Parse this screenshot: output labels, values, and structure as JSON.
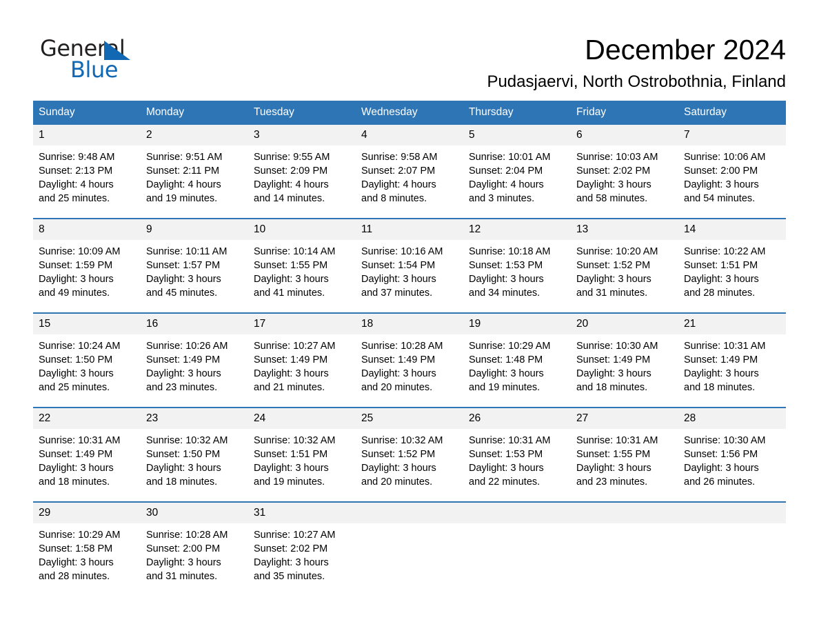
{
  "logo": {
    "word_one": "General",
    "word_two": "Blue",
    "triangle_icon": "triangle-icon",
    "accent_color": "#1268b3"
  },
  "header": {
    "title": "December 2024",
    "subtitle": "Pudasjaervi, North Ostrobothnia, Finland"
  },
  "theme": {
    "header_bg": "#2e75b6",
    "daynum_bg": "#f2f2f2",
    "text": "#000000",
    "page_bg": "#ffffff"
  },
  "calendar": {
    "weekday_headers": [
      "Sunday",
      "Monday",
      "Tuesday",
      "Wednesday",
      "Thursday",
      "Friday",
      "Saturday"
    ],
    "weeks": [
      [
        {
          "day": "1",
          "sunrise": "Sunrise: 9:48 AM",
          "sunset": "Sunset: 2:13 PM",
          "daylight_1": "Daylight: 4 hours",
          "daylight_2": "and 25 minutes."
        },
        {
          "day": "2",
          "sunrise": "Sunrise: 9:51 AM",
          "sunset": "Sunset: 2:11 PM",
          "daylight_1": "Daylight: 4 hours",
          "daylight_2": "and 19 minutes."
        },
        {
          "day": "3",
          "sunrise": "Sunrise: 9:55 AM",
          "sunset": "Sunset: 2:09 PM",
          "daylight_1": "Daylight: 4 hours",
          "daylight_2": "and 14 minutes."
        },
        {
          "day": "4",
          "sunrise": "Sunrise: 9:58 AM",
          "sunset": "Sunset: 2:07 PM",
          "daylight_1": "Daylight: 4 hours",
          "daylight_2": "and 8 minutes."
        },
        {
          "day": "5",
          "sunrise": "Sunrise: 10:01 AM",
          "sunset": "Sunset: 2:04 PM",
          "daylight_1": "Daylight: 4 hours",
          "daylight_2": "and 3 minutes."
        },
        {
          "day": "6",
          "sunrise": "Sunrise: 10:03 AM",
          "sunset": "Sunset: 2:02 PM",
          "daylight_1": "Daylight: 3 hours",
          "daylight_2": "and 58 minutes."
        },
        {
          "day": "7",
          "sunrise": "Sunrise: 10:06 AM",
          "sunset": "Sunset: 2:00 PM",
          "daylight_1": "Daylight: 3 hours",
          "daylight_2": "and 54 minutes."
        }
      ],
      [
        {
          "day": "8",
          "sunrise": "Sunrise: 10:09 AM",
          "sunset": "Sunset: 1:59 PM",
          "daylight_1": "Daylight: 3 hours",
          "daylight_2": "and 49 minutes."
        },
        {
          "day": "9",
          "sunrise": "Sunrise: 10:11 AM",
          "sunset": "Sunset: 1:57 PM",
          "daylight_1": "Daylight: 3 hours",
          "daylight_2": "and 45 minutes."
        },
        {
          "day": "10",
          "sunrise": "Sunrise: 10:14 AM",
          "sunset": "Sunset: 1:55 PM",
          "daylight_1": "Daylight: 3 hours",
          "daylight_2": "and 41 minutes."
        },
        {
          "day": "11",
          "sunrise": "Sunrise: 10:16 AM",
          "sunset": "Sunset: 1:54 PM",
          "daylight_1": "Daylight: 3 hours",
          "daylight_2": "and 37 minutes."
        },
        {
          "day": "12",
          "sunrise": "Sunrise: 10:18 AM",
          "sunset": "Sunset: 1:53 PM",
          "daylight_1": "Daylight: 3 hours",
          "daylight_2": "and 34 minutes."
        },
        {
          "day": "13",
          "sunrise": "Sunrise: 10:20 AM",
          "sunset": "Sunset: 1:52 PM",
          "daylight_1": "Daylight: 3 hours",
          "daylight_2": "and 31 minutes."
        },
        {
          "day": "14",
          "sunrise": "Sunrise: 10:22 AM",
          "sunset": "Sunset: 1:51 PM",
          "daylight_1": "Daylight: 3 hours",
          "daylight_2": "and 28 minutes."
        }
      ],
      [
        {
          "day": "15",
          "sunrise": "Sunrise: 10:24 AM",
          "sunset": "Sunset: 1:50 PM",
          "daylight_1": "Daylight: 3 hours",
          "daylight_2": "and 25 minutes."
        },
        {
          "day": "16",
          "sunrise": "Sunrise: 10:26 AM",
          "sunset": "Sunset: 1:49 PM",
          "daylight_1": "Daylight: 3 hours",
          "daylight_2": "and 23 minutes."
        },
        {
          "day": "17",
          "sunrise": "Sunrise: 10:27 AM",
          "sunset": "Sunset: 1:49 PM",
          "daylight_1": "Daylight: 3 hours",
          "daylight_2": "and 21 minutes."
        },
        {
          "day": "18",
          "sunrise": "Sunrise: 10:28 AM",
          "sunset": "Sunset: 1:49 PM",
          "daylight_1": "Daylight: 3 hours",
          "daylight_2": "and 20 minutes."
        },
        {
          "day": "19",
          "sunrise": "Sunrise: 10:29 AM",
          "sunset": "Sunset: 1:48 PM",
          "daylight_1": "Daylight: 3 hours",
          "daylight_2": "and 19 minutes."
        },
        {
          "day": "20",
          "sunrise": "Sunrise: 10:30 AM",
          "sunset": "Sunset: 1:49 PM",
          "daylight_1": "Daylight: 3 hours",
          "daylight_2": "and 18 minutes."
        },
        {
          "day": "21",
          "sunrise": "Sunrise: 10:31 AM",
          "sunset": "Sunset: 1:49 PM",
          "daylight_1": "Daylight: 3 hours",
          "daylight_2": "and 18 minutes."
        }
      ],
      [
        {
          "day": "22",
          "sunrise": "Sunrise: 10:31 AM",
          "sunset": "Sunset: 1:49 PM",
          "daylight_1": "Daylight: 3 hours",
          "daylight_2": "and 18 minutes."
        },
        {
          "day": "23",
          "sunrise": "Sunrise: 10:32 AM",
          "sunset": "Sunset: 1:50 PM",
          "daylight_1": "Daylight: 3 hours",
          "daylight_2": "and 18 minutes."
        },
        {
          "day": "24",
          "sunrise": "Sunrise: 10:32 AM",
          "sunset": "Sunset: 1:51 PM",
          "daylight_1": "Daylight: 3 hours",
          "daylight_2": "and 19 minutes."
        },
        {
          "day": "25",
          "sunrise": "Sunrise: 10:32 AM",
          "sunset": "Sunset: 1:52 PM",
          "daylight_1": "Daylight: 3 hours",
          "daylight_2": "and 20 minutes."
        },
        {
          "day": "26",
          "sunrise": "Sunrise: 10:31 AM",
          "sunset": "Sunset: 1:53 PM",
          "daylight_1": "Daylight: 3 hours",
          "daylight_2": "and 22 minutes."
        },
        {
          "day": "27",
          "sunrise": "Sunrise: 10:31 AM",
          "sunset": "Sunset: 1:55 PM",
          "daylight_1": "Daylight: 3 hours",
          "daylight_2": "and 23 minutes."
        },
        {
          "day": "28",
          "sunrise": "Sunrise: 10:30 AM",
          "sunset": "Sunset: 1:56 PM",
          "daylight_1": "Daylight: 3 hours",
          "daylight_2": "and 26 minutes."
        }
      ],
      [
        {
          "day": "29",
          "sunrise": "Sunrise: 10:29 AM",
          "sunset": "Sunset: 1:58 PM",
          "daylight_1": "Daylight: 3 hours",
          "daylight_2": "and 28 minutes."
        },
        {
          "day": "30",
          "sunrise": "Sunrise: 10:28 AM",
          "sunset": "Sunset: 2:00 PM",
          "daylight_1": "Daylight: 3 hours",
          "daylight_2": "and 31 minutes."
        },
        {
          "day": "31",
          "sunrise": "Sunrise: 10:27 AM",
          "sunset": "Sunset: 2:02 PM",
          "daylight_1": "Daylight: 3 hours",
          "daylight_2": "and 35 minutes."
        },
        {
          "day": "",
          "sunrise": "",
          "sunset": "",
          "daylight_1": "",
          "daylight_2": ""
        },
        {
          "day": "",
          "sunrise": "",
          "sunset": "",
          "daylight_1": "",
          "daylight_2": ""
        },
        {
          "day": "",
          "sunrise": "",
          "sunset": "",
          "daylight_1": "",
          "daylight_2": ""
        },
        {
          "day": "",
          "sunrise": "",
          "sunset": "",
          "daylight_1": "",
          "daylight_2": ""
        }
      ]
    ]
  }
}
